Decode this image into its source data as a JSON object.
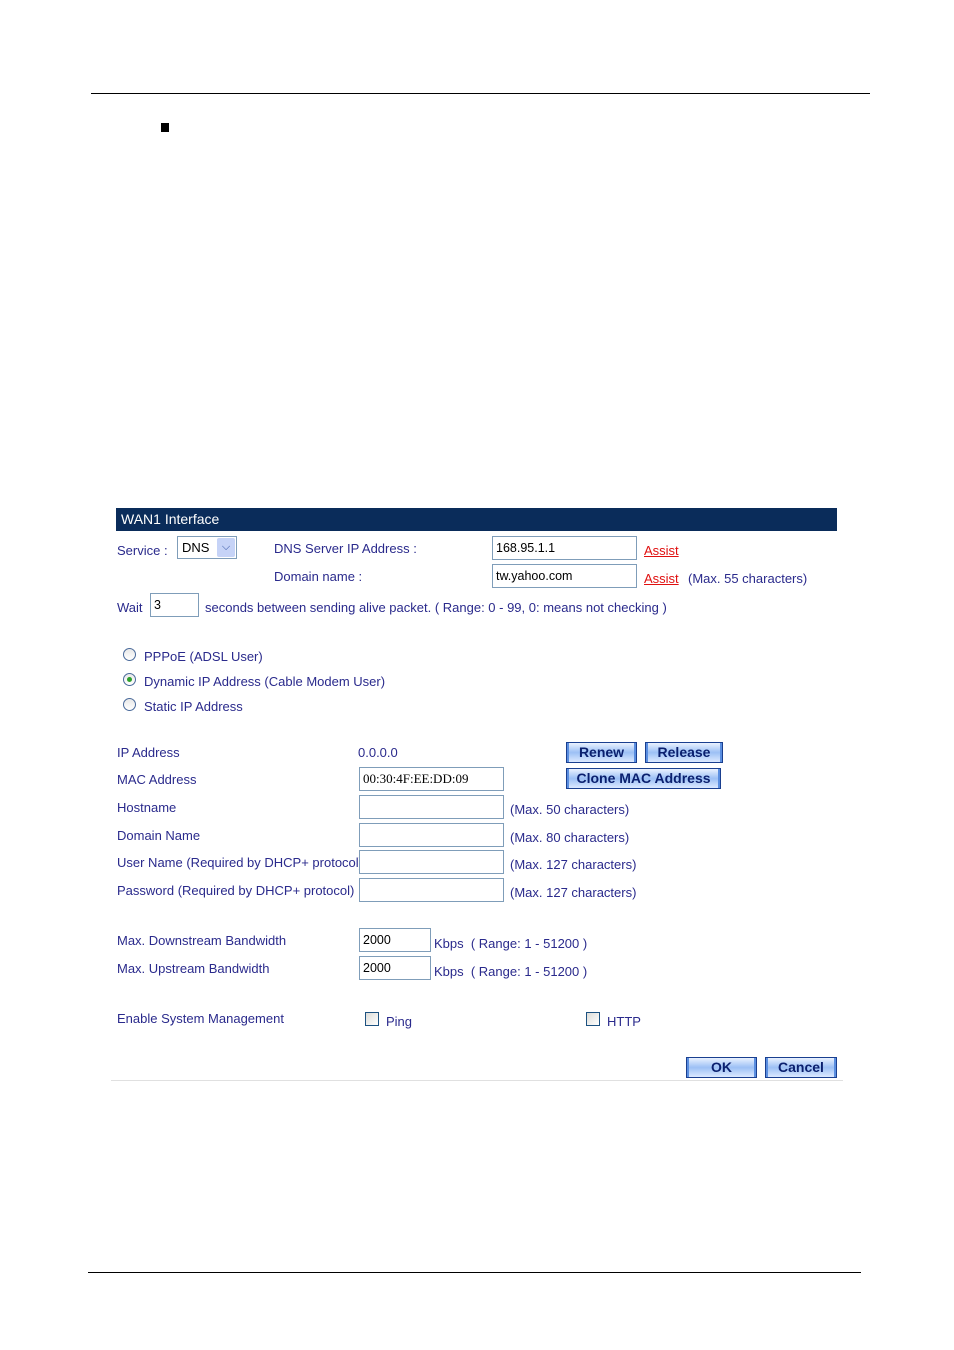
{
  "panel": {
    "title": "WAN1 Interface"
  },
  "service": {
    "label": "Service :",
    "selected": "DNS",
    "dropdown_icon": "chevron-down-icon",
    "dns_server_label": "DNS Server IP Address :",
    "dns_server_value": "168.95.1.1",
    "domain_label": "Domain name :",
    "domain_value": "tw.yahoo.com",
    "assist_label": "Assist",
    "domain_hint": "(Max. 55 characters)"
  },
  "wait": {
    "label": "Wait",
    "value": "3",
    "hint": "seconds between sending alive packet. ( Range: 0 - 99, 0: means not checking )"
  },
  "connection_types": [
    {
      "label": "PPPoE (ADSL User)",
      "selected": false
    },
    {
      "label": "Dynamic IP Address (Cable Modem User)",
      "selected": true
    },
    {
      "label": "Static IP Address",
      "selected": false
    }
  ],
  "fields": {
    "ip_label": "IP Address",
    "ip_value": "0.0.0.0",
    "renew": "Renew",
    "release": "Release",
    "mac_label": "MAC Address",
    "mac_value": "00:30:4F:EE:DD:09",
    "clone_mac": "Clone MAC Address",
    "hostname_label": "Hostname",
    "hostname_value": "",
    "hostname_hint": "(Max. 50 characters)",
    "domain_name_label": "Domain Name",
    "domain_name_value": "",
    "domain_name_hint": "(Max. 80 characters)",
    "username_label": "User Name (Required by DHCP+ protocol)",
    "username_value": "",
    "username_hint": "(Max. 127 characters)",
    "password_label": "Password (Required by DHCP+ protocol)",
    "password_value": "",
    "password_hint": "(Max. 127 characters)"
  },
  "bandwidth": {
    "down_label": "Max. Downstream Bandwidth",
    "down_value": "2000",
    "up_label": "Max. Upstream Bandwidth",
    "up_value": "2000",
    "unit_hint": "Kbps  ( Range: 1 - 51200 )"
  },
  "management": {
    "label": "Enable System Management",
    "ping": "Ping",
    "ping_checked": false,
    "http": "HTTP",
    "http_checked": false
  },
  "actions": {
    "ok": "OK",
    "cancel": "Cancel"
  }
}
